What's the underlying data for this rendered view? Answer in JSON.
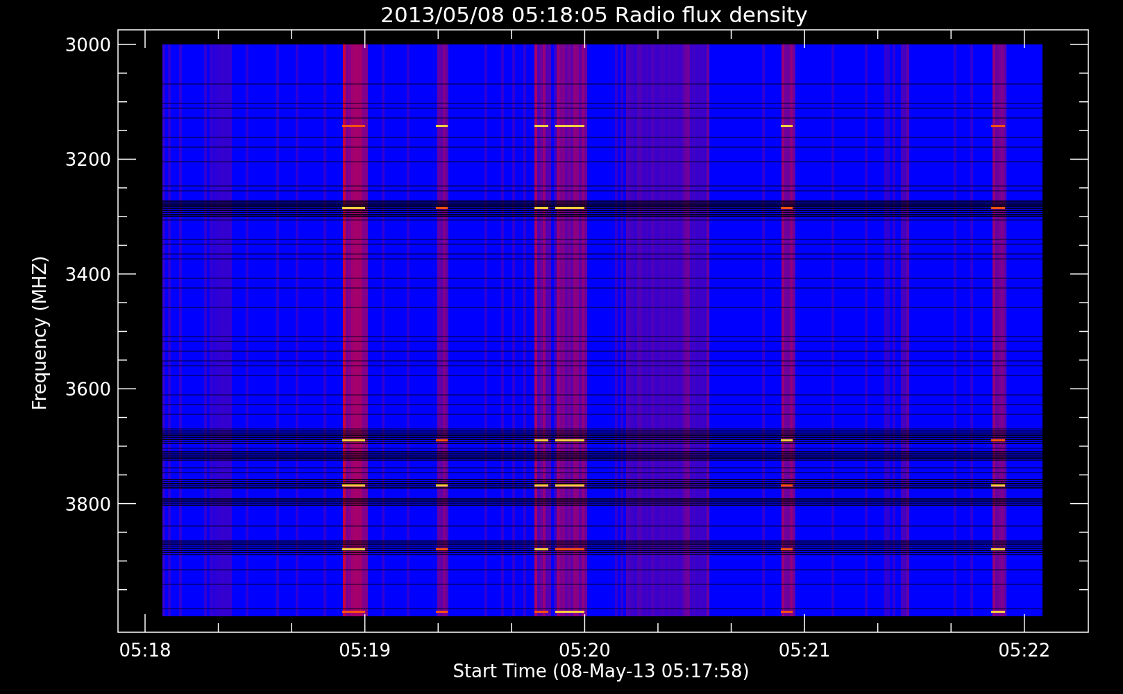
{
  "title": "2013/05/08 05:18:05 Radio flux density",
  "ylabel": "Frequency (MHZ)",
  "xlabel": "Start Time (08-May-13 05:17:58)",
  "yticks": [
    "3000",
    "3200",
    "3400",
    "3600",
    "3800"
  ],
  "xticks": [
    "05:18",
    "05:19",
    "05:20",
    "05:21",
    "05:22"
  ]
}
